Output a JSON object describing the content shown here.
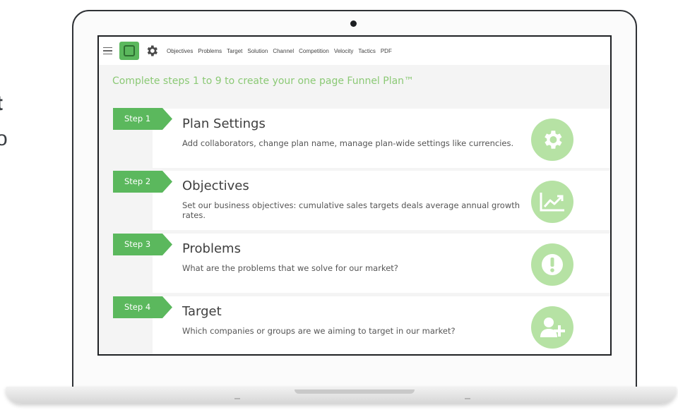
{
  "edge_text": {
    "line1": "t",
    "line2": "o"
  },
  "app": {
    "nav": {
      "items": [
        "Objectives",
        "Problems",
        "Target",
        "Solution",
        "Channel",
        "Competition",
        "Velocity",
        "Tactics",
        "PDF"
      ]
    },
    "headline": "Complete steps 1 to 9 to create your one page Funnel Plan™",
    "steps": [
      {
        "tab": "Step 1",
        "title": "Plan Settings",
        "description": "Add collaborators, change plan name, manage plan-wide settings like currencies.",
        "icon": "gear-icon"
      },
      {
        "tab": "Step 2",
        "title": "Objectives",
        "description": "Set our business objectives: cumulative sales targets deals average annual growth rates.",
        "icon": "trend-chart-icon"
      },
      {
        "tab": "Step 3",
        "title": "Problems",
        "description": "What are the problems that we solve for our market?",
        "icon": "exclamation-icon"
      },
      {
        "tab": "Step 4",
        "title": "Target",
        "description": "Which companies or groups are we aiming to target in our market?",
        "icon": "add-user-icon"
      }
    ]
  },
  "colors": {
    "accent": "#5bb85d",
    "icon_bg": "#b6e2a4",
    "headline": "#8bc975"
  }
}
